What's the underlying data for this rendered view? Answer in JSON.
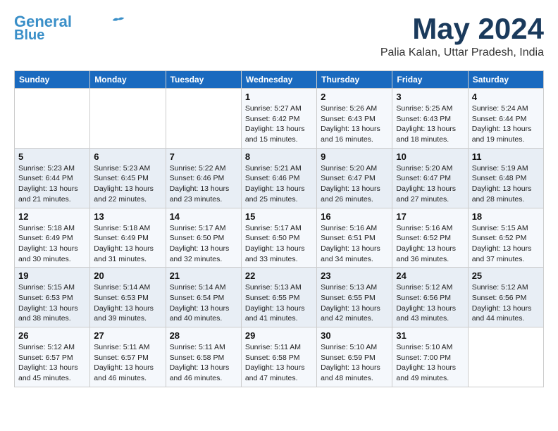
{
  "header": {
    "logo_line1": "General",
    "logo_line2": "Blue",
    "month": "May 2024",
    "location": "Palia Kalan, Uttar Pradesh, India"
  },
  "weekdays": [
    "Sunday",
    "Monday",
    "Tuesday",
    "Wednesday",
    "Thursday",
    "Friday",
    "Saturday"
  ],
  "weeks": [
    [
      {
        "day": "",
        "info": ""
      },
      {
        "day": "",
        "info": ""
      },
      {
        "day": "",
        "info": ""
      },
      {
        "day": "1",
        "info": "Sunrise: 5:27 AM\nSunset: 6:42 PM\nDaylight: 13 hours\nand 15 minutes."
      },
      {
        "day": "2",
        "info": "Sunrise: 5:26 AM\nSunset: 6:43 PM\nDaylight: 13 hours\nand 16 minutes."
      },
      {
        "day": "3",
        "info": "Sunrise: 5:25 AM\nSunset: 6:43 PM\nDaylight: 13 hours\nand 18 minutes."
      },
      {
        "day": "4",
        "info": "Sunrise: 5:24 AM\nSunset: 6:44 PM\nDaylight: 13 hours\nand 19 minutes."
      }
    ],
    [
      {
        "day": "5",
        "info": "Sunrise: 5:23 AM\nSunset: 6:44 PM\nDaylight: 13 hours\nand 21 minutes."
      },
      {
        "day": "6",
        "info": "Sunrise: 5:23 AM\nSunset: 6:45 PM\nDaylight: 13 hours\nand 22 minutes."
      },
      {
        "day": "7",
        "info": "Sunrise: 5:22 AM\nSunset: 6:46 PM\nDaylight: 13 hours\nand 23 minutes."
      },
      {
        "day": "8",
        "info": "Sunrise: 5:21 AM\nSunset: 6:46 PM\nDaylight: 13 hours\nand 25 minutes."
      },
      {
        "day": "9",
        "info": "Sunrise: 5:20 AM\nSunset: 6:47 PM\nDaylight: 13 hours\nand 26 minutes."
      },
      {
        "day": "10",
        "info": "Sunrise: 5:20 AM\nSunset: 6:47 PM\nDaylight: 13 hours\nand 27 minutes."
      },
      {
        "day": "11",
        "info": "Sunrise: 5:19 AM\nSunset: 6:48 PM\nDaylight: 13 hours\nand 28 minutes."
      }
    ],
    [
      {
        "day": "12",
        "info": "Sunrise: 5:18 AM\nSunset: 6:49 PM\nDaylight: 13 hours\nand 30 minutes."
      },
      {
        "day": "13",
        "info": "Sunrise: 5:18 AM\nSunset: 6:49 PM\nDaylight: 13 hours\nand 31 minutes."
      },
      {
        "day": "14",
        "info": "Sunrise: 5:17 AM\nSunset: 6:50 PM\nDaylight: 13 hours\nand 32 minutes."
      },
      {
        "day": "15",
        "info": "Sunrise: 5:17 AM\nSunset: 6:50 PM\nDaylight: 13 hours\nand 33 minutes."
      },
      {
        "day": "16",
        "info": "Sunrise: 5:16 AM\nSunset: 6:51 PM\nDaylight: 13 hours\nand 34 minutes."
      },
      {
        "day": "17",
        "info": "Sunrise: 5:16 AM\nSunset: 6:52 PM\nDaylight: 13 hours\nand 36 minutes."
      },
      {
        "day": "18",
        "info": "Sunrise: 5:15 AM\nSunset: 6:52 PM\nDaylight: 13 hours\nand 37 minutes."
      }
    ],
    [
      {
        "day": "19",
        "info": "Sunrise: 5:15 AM\nSunset: 6:53 PM\nDaylight: 13 hours\nand 38 minutes."
      },
      {
        "day": "20",
        "info": "Sunrise: 5:14 AM\nSunset: 6:53 PM\nDaylight: 13 hours\nand 39 minutes."
      },
      {
        "day": "21",
        "info": "Sunrise: 5:14 AM\nSunset: 6:54 PM\nDaylight: 13 hours\nand 40 minutes."
      },
      {
        "day": "22",
        "info": "Sunrise: 5:13 AM\nSunset: 6:55 PM\nDaylight: 13 hours\nand 41 minutes."
      },
      {
        "day": "23",
        "info": "Sunrise: 5:13 AM\nSunset: 6:55 PM\nDaylight: 13 hours\nand 42 minutes."
      },
      {
        "day": "24",
        "info": "Sunrise: 5:12 AM\nSunset: 6:56 PM\nDaylight: 13 hours\nand 43 minutes."
      },
      {
        "day": "25",
        "info": "Sunrise: 5:12 AM\nSunset: 6:56 PM\nDaylight: 13 hours\nand 44 minutes."
      }
    ],
    [
      {
        "day": "26",
        "info": "Sunrise: 5:12 AM\nSunset: 6:57 PM\nDaylight: 13 hours\nand 45 minutes."
      },
      {
        "day": "27",
        "info": "Sunrise: 5:11 AM\nSunset: 6:57 PM\nDaylight: 13 hours\nand 46 minutes."
      },
      {
        "day": "28",
        "info": "Sunrise: 5:11 AM\nSunset: 6:58 PM\nDaylight: 13 hours\nand 46 minutes."
      },
      {
        "day": "29",
        "info": "Sunrise: 5:11 AM\nSunset: 6:58 PM\nDaylight: 13 hours\nand 47 minutes."
      },
      {
        "day": "30",
        "info": "Sunrise: 5:10 AM\nSunset: 6:59 PM\nDaylight: 13 hours\nand 48 minutes."
      },
      {
        "day": "31",
        "info": "Sunrise: 5:10 AM\nSunset: 7:00 PM\nDaylight: 13 hours\nand 49 minutes."
      },
      {
        "day": "",
        "info": ""
      }
    ]
  ]
}
